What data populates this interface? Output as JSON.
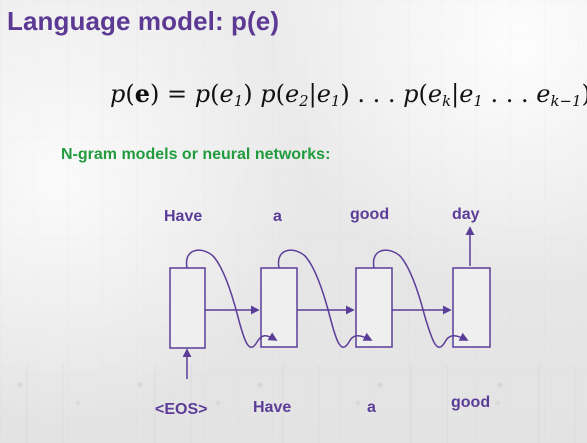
{
  "slide": {
    "title": "Language model: p(e)",
    "subtitle": "N-gram models or neural networks:",
    "equation": {
      "text": "p(e) = p(e1)p(e2|e1) . . . p(ek|e1 . . . ek−1)"
    },
    "diagram": {
      "top_words": [
        "Have",
        "a",
        "good",
        "day"
      ],
      "bottom_words": [
        "<EOS>",
        "Have",
        "a",
        "good"
      ]
    }
  },
  "colors": {
    "title": "#5c3a94",
    "subtitle": "#219b3d",
    "diagram": "#5b3d98",
    "equation": "#111111"
  }
}
